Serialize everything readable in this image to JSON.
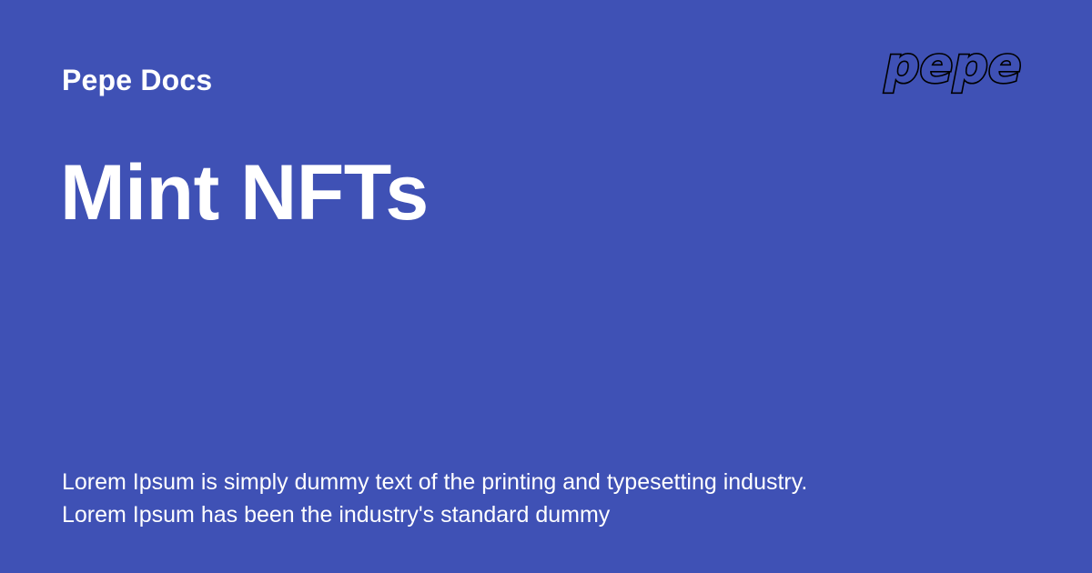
{
  "header": {
    "site_name": "Pepe Docs",
    "logo_text": "pepe"
  },
  "main": {
    "title": "Mint NFTs",
    "description": "Lorem Ipsum is simply dummy text of the printing and typesetting industry. Lorem Ipsum has been the industry's standard dummy"
  },
  "colors": {
    "background": "#3f51b5",
    "text": "#ffffff",
    "logo_outline": "#000000"
  },
  "icons": {
    "logo": "pepe-wordmark-logo"
  }
}
